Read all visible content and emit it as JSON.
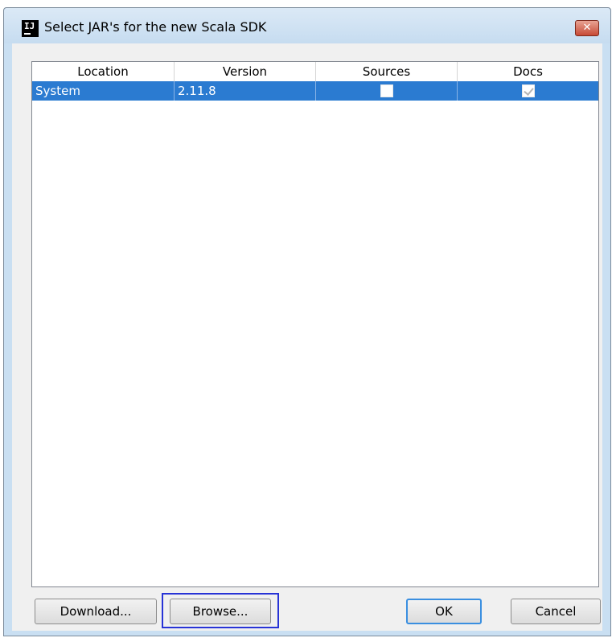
{
  "window": {
    "title": "Select JAR's for the new Scala SDK",
    "app_icon_text": "IJ",
    "close_symbol": "✕"
  },
  "table": {
    "columns": [
      "Location",
      "Version",
      "Sources",
      "Docs"
    ],
    "rows": [
      {
        "location": "System",
        "version": "2.11.8",
        "sources_checked": false,
        "docs_checked": true,
        "selected": true
      }
    ]
  },
  "buttons": {
    "download": "Download...",
    "browse": "Browse...",
    "ok": "OK",
    "cancel": "Cancel"
  },
  "colors": {
    "selection": "#2b7bd1",
    "titlebar": "#c9dff2",
    "focus_highlight": "#2733d6"
  }
}
